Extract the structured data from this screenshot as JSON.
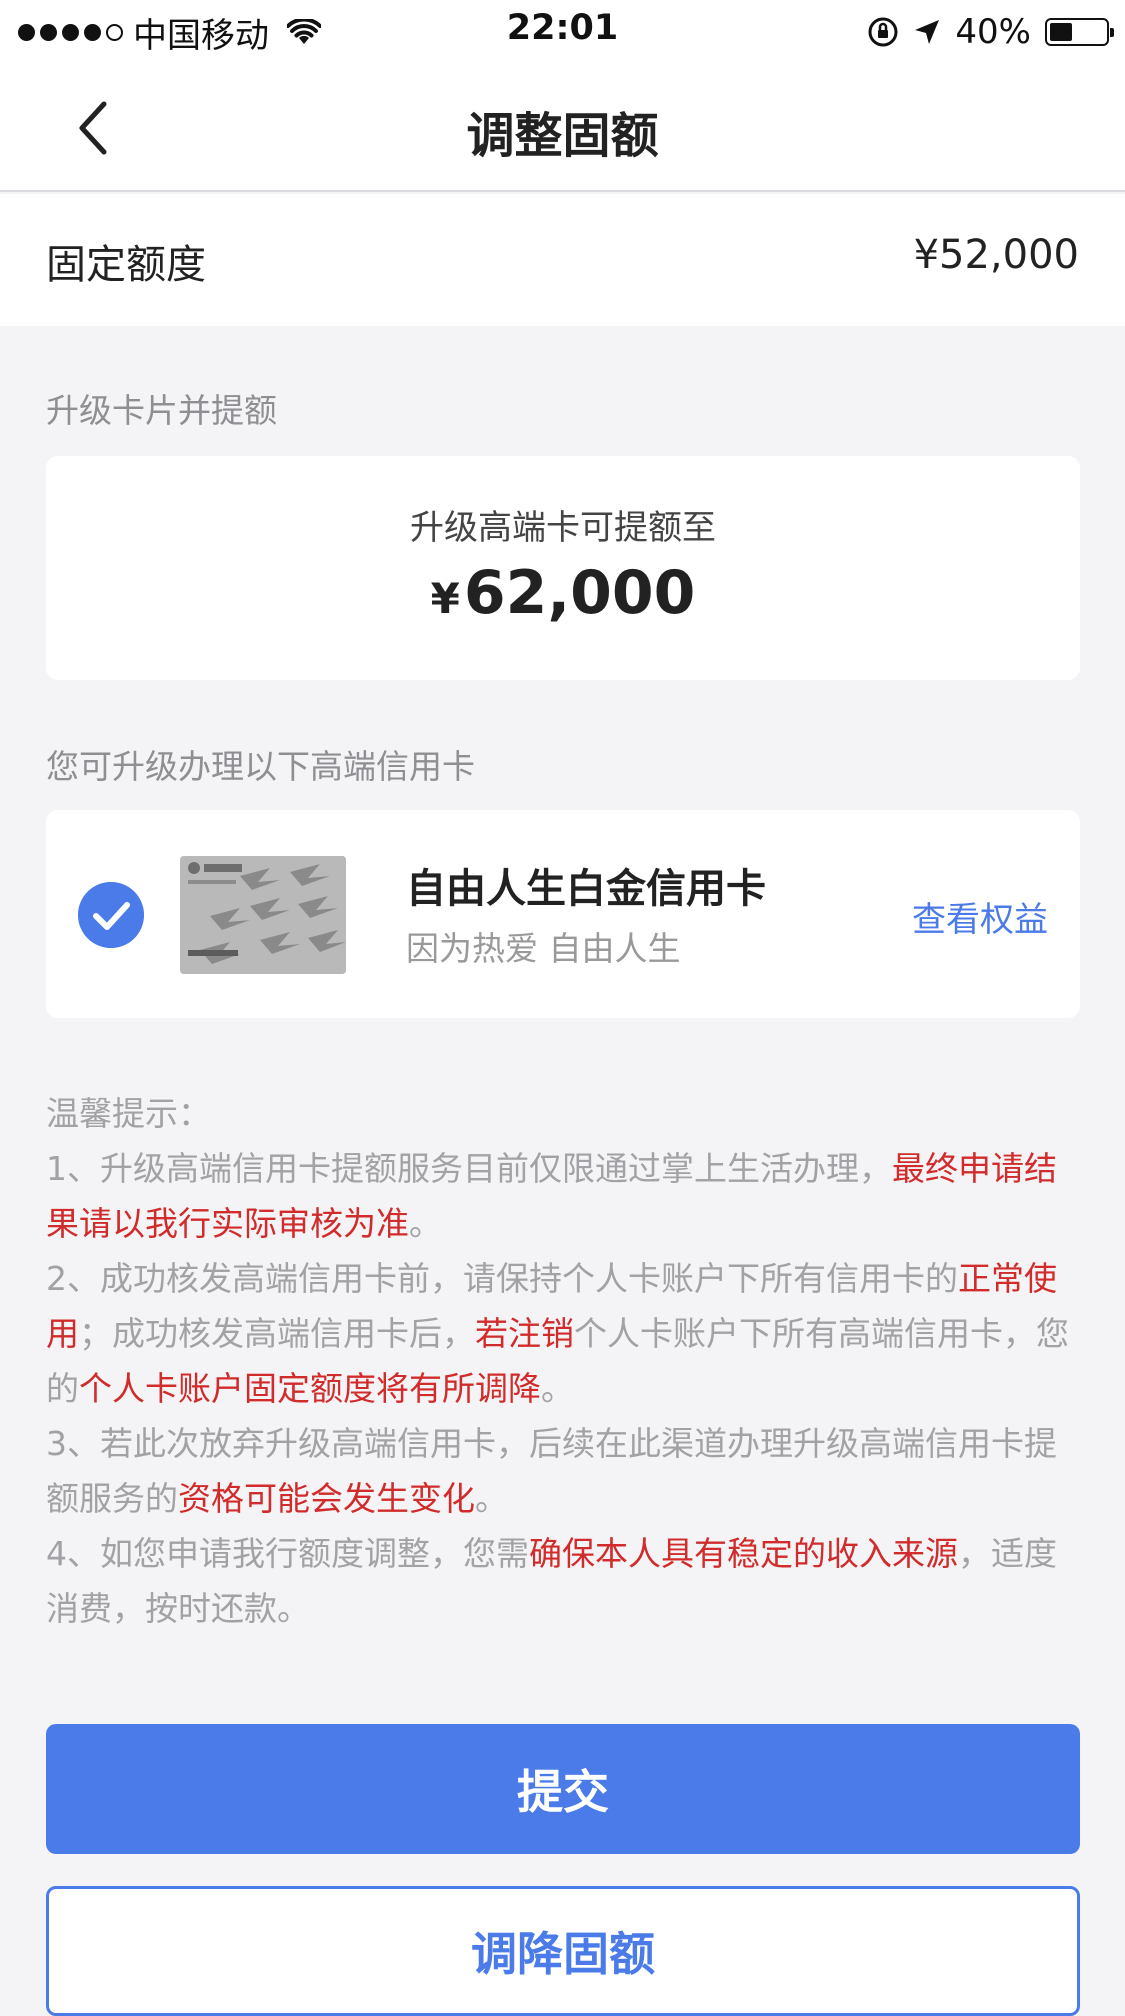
{
  "status_bar": {
    "carrier": "中国移动",
    "time": "22:01",
    "battery_percent": "40%",
    "battery_level": 0.4
  },
  "nav": {
    "title": "调整固额",
    "back_icon": "chevron-left-icon"
  },
  "fixed_limit": {
    "label": "固定额度",
    "value": "¥52,000"
  },
  "upgrade_section": {
    "label": "升级卡片并提额",
    "subtitle": "升级高端卡可提额至",
    "currency": "¥",
    "amount": "62,000"
  },
  "cards_section": {
    "label": "您可升级办理以下高端信用卡",
    "card": {
      "name": "自由人生白金信用卡",
      "slogan": "因为热爱 自由人生",
      "link_label": "查看权益",
      "selected": true
    }
  },
  "tips": {
    "title": "温馨提示：",
    "item1_a": "1、升级高端信用卡提额服务目前仅限通过掌上生活办理，",
    "item1_b": "最终申请结果请以我行实际审核为准",
    "item1_c": "。",
    "item2_a": "2、成功核发高端信用卡前，请保持个人卡账户下所有信用卡的",
    "item2_b": "正常使用",
    "item2_c": "；成功核发高端信用卡后，",
    "item2_d": "若注销",
    "item2_e": "个人卡账户下所有高端信用卡，您的",
    "item2_f": "个人卡账户固定额度将有所调降",
    "item2_g": "。",
    "item3_a": "3、若此次放弃升级高端信用卡，后续在此渠道办理升级高端信用卡提额服务的",
    "item3_b": "资格可能会发生变化",
    "item3_c": "。",
    "item4_a": "4、如您申请我行额度调整，您需",
    "item4_b": "确保本人具有稳定的收入来源",
    "item4_c": "，适度消费，按时还款。"
  },
  "buttons": {
    "submit": "提交",
    "decrease": "调降固额"
  },
  "colors": {
    "accent": "#4a7be8",
    "warning": "#d12b2b",
    "background": "#f4f4f6"
  }
}
